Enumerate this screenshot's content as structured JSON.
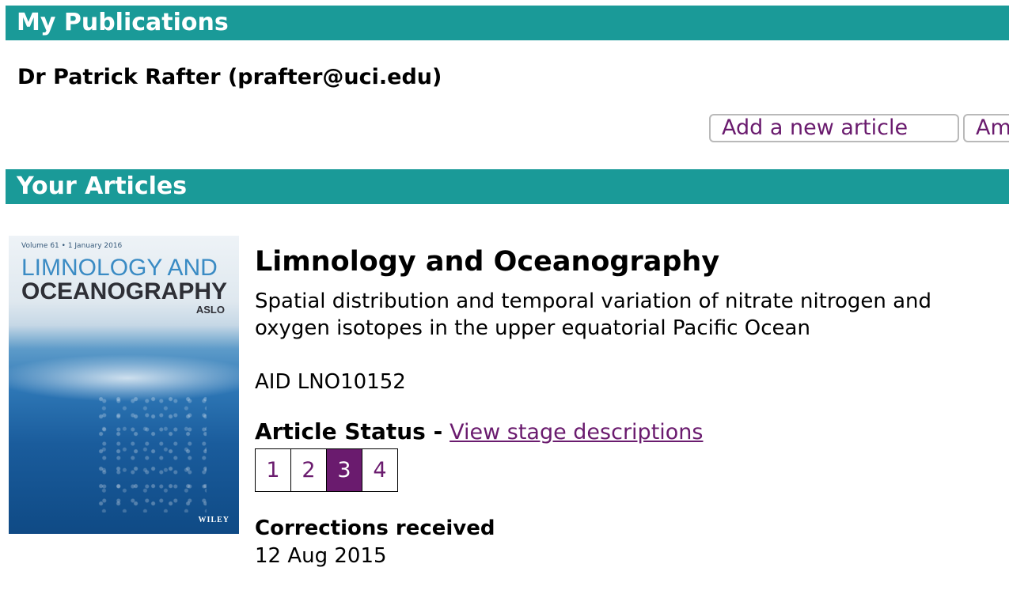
{
  "header": {
    "title": "My Publications",
    "user": "Dr Patrick Rafter (prafter@uci.edu)"
  },
  "actions": {
    "add_article": "Add a new article",
    "amend_partial": "Am"
  },
  "articles_section": {
    "title": "Your Articles"
  },
  "article": {
    "cover": {
      "issue_line": "Volume 61 • 1 January 2016",
      "title_line1": "LIMNOLOGY AND",
      "title_line2": "OCEANOGRAPHY",
      "publisher_mark": "ASLO",
      "wiley_mark": "WILEY"
    },
    "journal": "Limnology and Oceanography",
    "title": "Spatial distribution and temporal variation of nitrate nitrogen and oxygen isotopes in the upper equatorial Pacific Ocean",
    "aid": "AID LNO10152",
    "status_label": "Article Status -",
    "status_link": "View stage descriptions",
    "stages": [
      "1",
      "2",
      "3",
      "4"
    ],
    "active_stage": "3",
    "current_stage_name": "Corrections received",
    "current_stage_date": "12 Aug 2015"
  },
  "colors": {
    "section_bar": "#1a9a98",
    "link_purple": "#6a1b6e"
  }
}
